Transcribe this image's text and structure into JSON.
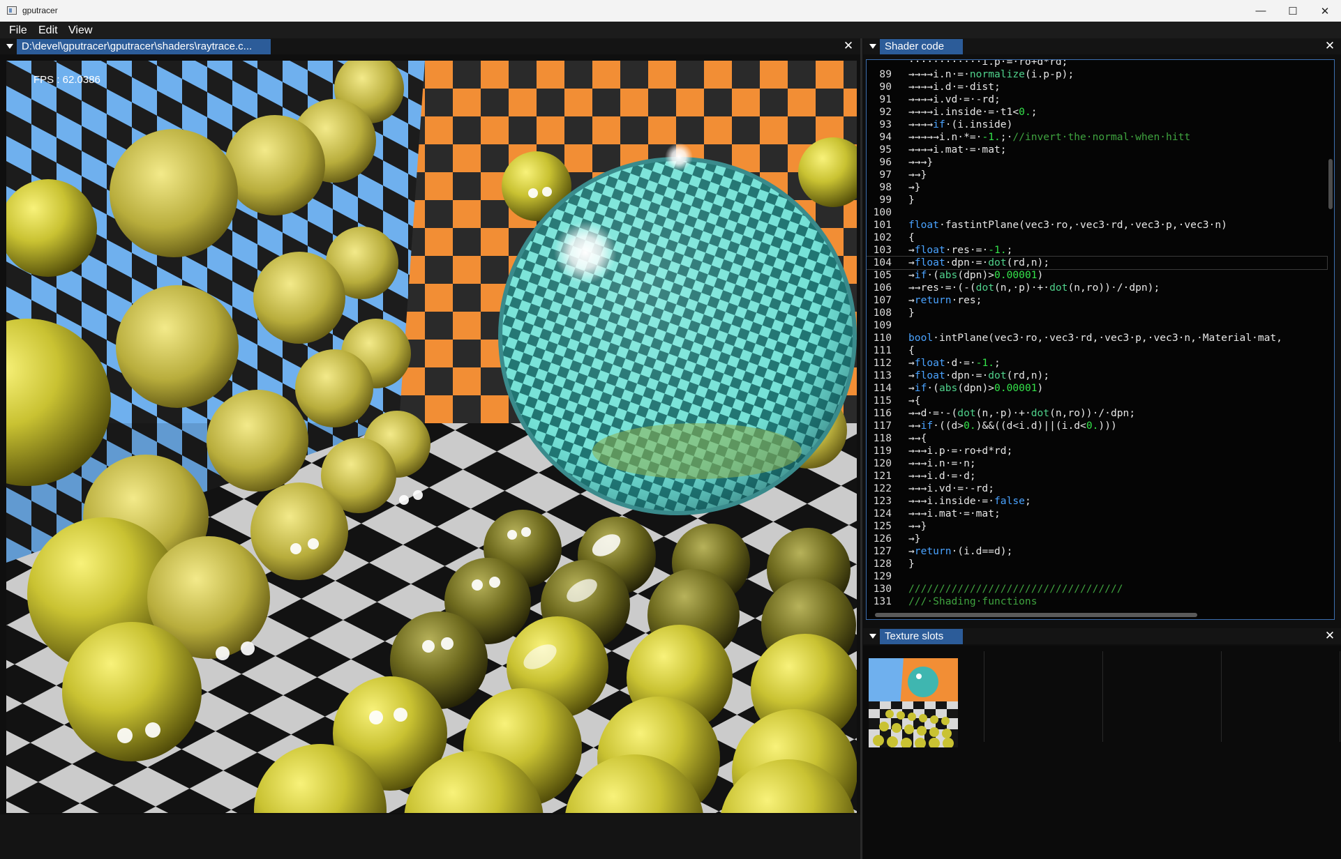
{
  "window": {
    "title": "gputracer",
    "minimize": "—",
    "maximize": "☐",
    "close": "✕"
  },
  "menu": {
    "file": "File",
    "edit": "Edit",
    "view": "View"
  },
  "viewport_panel": {
    "tab": "D:\\devel\\gputracer\\gputracer\\shaders\\raytrace.c...",
    "close": "✕",
    "fps": "FPS : 62.0386"
  },
  "shader_panel": {
    "tab": "Shader code",
    "close": "✕",
    "current_line": 104
  },
  "code_lines": [
    {
      "n": "",
      "t": "············i.p·=·ro+d*rd;"
    },
    {
      "n": "89",
      "t": "→→→→i.n·=·<fn>normalize</fn>(i.p-p);"
    },
    {
      "n": "90",
      "t": "→→→→i.d·=·dist;"
    },
    {
      "n": "91",
      "t": "→→→→i.vd·=·-rd;"
    },
    {
      "n": "92",
      "t": "→→→→i.inside·=·t1<<num>0.</num>;"
    },
    {
      "n": "93",
      "t": "→→→→<kw>if</kw>·(i.inside)"
    },
    {
      "n": "94",
      "t": "→→→→→i.n·*=·<num>-1.</num>;·<cm>//invert·the·normal·when·hitt</cm>"
    },
    {
      "n": "95",
      "t": "→→→→i.mat·=·mat;"
    },
    {
      "n": "96",
      "t": "→→→}"
    },
    {
      "n": "97",
      "t": "→→}"
    },
    {
      "n": "98",
      "t": "→}"
    },
    {
      "n": "99",
      "t": "}"
    },
    {
      "n": "100",
      "t": ""
    },
    {
      "n": "101",
      "t": "<kw>float</kw>·fastintPlane(vec3·ro,·vec3·rd,·vec3·p,·vec3·n)"
    },
    {
      "n": "102",
      "t": "{"
    },
    {
      "n": "103",
      "t": "→<kw>float</kw>·res·=·<num>-1.</num>;"
    },
    {
      "n": "104",
      "t": "→<kw>float</kw>·dpn·=·<fn>dot</fn>(rd,n);"
    },
    {
      "n": "105",
      "t": "→<kw>if</kw>·(<fn>abs</fn>(dpn)><num>0.00001</num>)"
    },
    {
      "n": "106",
      "t": "→→res·=·(-(<fn>dot</fn>(n,·p)·+·<fn>dot</fn>(n,ro))·/·dpn);"
    },
    {
      "n": "107",
      "t": "→<kw>return</kw>·res;"
    },
    {
      "n": "108",
      "t": "}"
    },
    {
      "n": "109",
      "t": ""
    },
    {
      "n": "110",
      "t": "<kw>bool</kw>·intPlane(vec3·ro,·vec3·rd,·vec3·p,·vec3·n,·Material·mat,"
    },
    {
      "n": "111",
      "t": "{"
    },
    {
      "n": "112",
      "t": "→<kw>float</kw>·d·=·<num>-1.</num>;"
    },
    {
      "n": "113",
      "t": "→<kw>float</kw>·dpn·=·<fn>dot</fn>(rd,n);"
    },
    {
      "n": "114",
      "t": "→<kw>if</kw>·(<fn>abs</fn>(dpn)><num>0.00001</num>)"
    },
    {
      "n": "115",
      "t": "→{"
    },
    {
      "n": "116",
      "t": "→→d·=·-(<fn>dot</fn>(n,·p)·+·<fn>dot</fn>(n,ro))·/·dpn;"
    },
    {
      "n": "117",
      "t": "→→<kw>if</kw>·((d><num>0.</num>)&&((d<i.d)||(i.d<<num>0.</num>)))"
    },
    {
      "n": "118",
      "t": "→→{"
    },
    {
      "n": "119",
      "t": "→→→i.p·=·ro+d*rd;"
    },
    {
      "n": "120",
      "t": "→→→i.n·=·n;"
    },
    {
      "n": "121",
      "t": "→→→i.d·=·d;"
    },
    {
      "n": "122",
      "t": "→→→i.vd·=·-rd;"
    },
    {
      "n": "123",
      "t": "→→→i.inside·=·<kw>false</kw>;"
    },
    {
      "n": "124",
      "t": "→→→i.mat·=·mat;"
    },
    {
      "n": "125",
      "t": "→→}"
    },
    {
      "n": "126",
      "t": "→}"
    },
    {
      "n": "127",
      "t": "→<kw>return</kw>·(i.d==d);"
    },
    {
      "n": "128",
      "t": "}"
    },
    {
      "n": "129",
      "t": ""
    },
    {
      "n": "130",
      "t": "<cm>///////////////////////////////////</cm>"
    },
    {
      "n": "131",
      "t": "<cm>///·Shading·functions</cm>"
    }
  ],
  "texture_panel": {
    "tab": "Texture slots",
    "close": "✕"
  },
  "colors": {
    "accent": "#2c5c99",
    "keyword": "#4aa3ff",
    "number": "#34e34a",
    "function": "#4fd18b",
    "comment": "#3fa33f",
    "text": "#e6e6e6"
  }
}
